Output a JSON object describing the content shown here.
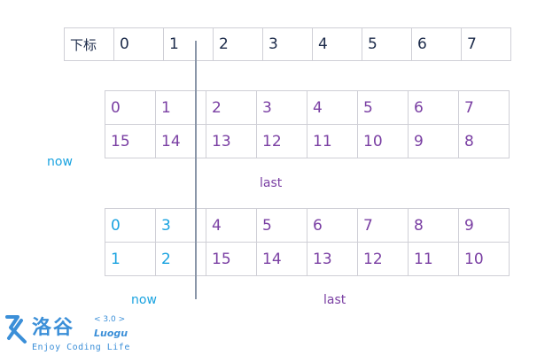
{
  "index_row": {
    "header": "下标",
    "cells": [
      "0",
      "1",
      "2",
      "3",
      "4",
      "5",
      "6",
      "7"
    ]
  },
  "middle": {
    "row1": [
      "0",
      "1",
      "2",
      "3",
      "4",
      "5",
      "6",
      "7"
    ],
    "row2": [
      "15",
      "14",
      "13",
      "12",
      "11",
      "10",
      "9",
      "8"
    ],
    "label_now": "now",
    "label_last": "last"
  },
  "bottom": {
    "row1": [
      "0",
      "3",
      "4",
      "5",
      "6",
      "7",
      "8",
      "9"
    ],
    "row2": [
      "1",
      "2",
      "15",
      "14",
      "13",
      "12",
      "11",
      "10"
    ],
    "label_now": "now",
    "label_last": "last"
  },
  "logo": {
    "chinese": "洛谷",
    "version": "< 3.0 >",
    "english": "Luogu",
    "slogan": "Enjoy Coding Life"
  },
  "colors": {
    "now": "#1aa3e0",
    "last": "#7a3fa3",
    "index_text": "#1c2b4a",
    "logo": "#3b8fd8"
  }
}
